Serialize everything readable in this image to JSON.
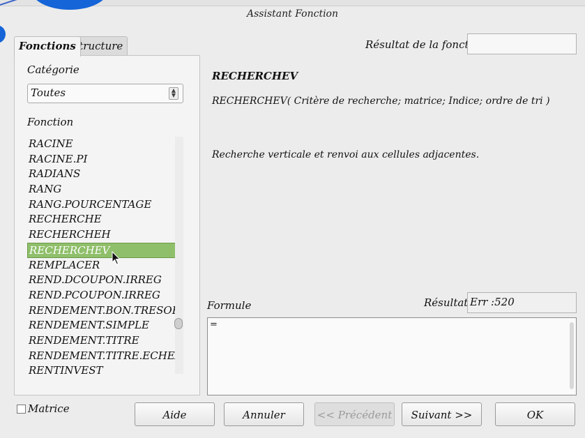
{
  "window": {
    "title": "Assistant Fonction"
  },
  "tabs": [
    {
      "label": "Fonctions",
      "active": true
    },
    {
      "label": "Structure",
      "active": false
    }
  ],
  "left": {
    "category_label": "Catégorie",
    "category_value": "Toutes",
    "function_label": "Fonction",
    "functions": [
      "RACINE",
      "RACINE.PI",
      "RADIANS",
      "RANG",
      "RANG.POURCENTAGE",
      "RECHERCHE",
      "RECHERCHEH",
      "RECHERCHEV",
      "REMPLACER",
      "REND.DCOUPON.IRREG",
      "REND.PCOUPON.IRREG",
      "RENDEMENT.BON.TRESOR",
      "RENDEMENT.SIMPLE",
      "RENDEMENT.TITRE",
      "RENDEMENT.TITRE.ECHEAN",
      "RENTINVEST"
    ],
    "selected_function": "RECHERCHEV"
  },
  "right": {
    "result_of_function_label": "Résultat de la fonction",
    "result_of_function_value": "",
    "function_name": "RECHERCHEV",
    "function_syntax": "RECHERCHEV( Critère de recherche; matrice; Indice; ordre de tri )",
    "function_description": "Recherche verticale et renvoi aux cellules adjacentes.",
    "formula_label": "Formule",
    "formula_value": "=",
    "result_label": "Résultat",
    "result_value": "Err :520"
  },
  "bottom": {
    "matrix_label": "Matrice",
    "matrix_checked": false,
    "buttons": {
      "help": "Aide",
      "cancel": "Annuler",
      "previous": "<< Précédent",
      "next": "Suivant >>",
      "ok": "OK"
    }
  },
  "colors": {
    "selection": "#8fbf6a",
    "accent_blue": "#1565d8"
  }
}
